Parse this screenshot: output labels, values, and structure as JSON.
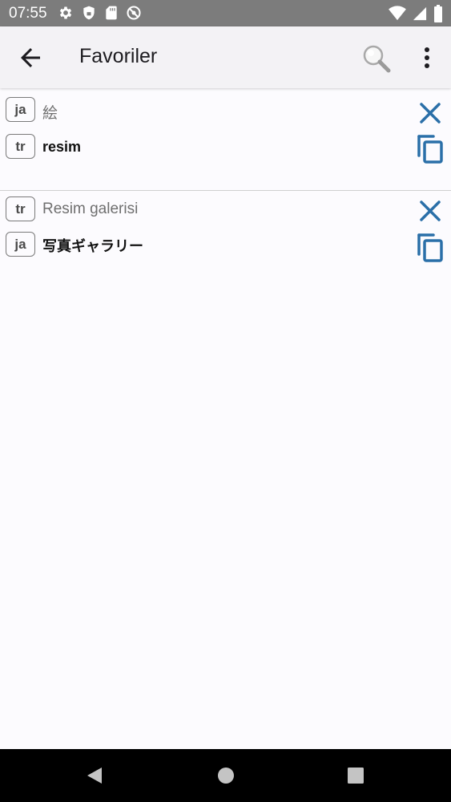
{
  "status_bar": {
    "time": "07:55",
    "left_icons": [
      "gear-icon",
      "shield-icon",
      "sd-card-icon",
      "do-not-disturb-icon"
    ],
    "right_icons": [
      "wifi-icon",
      "signal-icon",
      "battery-icon"
    ]
  },
  "app_bar": {
    "title": "Favoriler",
    "back_icon": "arrow-back-icon",
    "search_icon": "search-icon",
    "more_icon": "more-vert-icon"
  },
  "favorites": [
    {
      "source_lang": "ja",
      "source_text": "絵",
      "target_lang": "tr",
      "target_text": "resim"
    },
    {
      "source_lang": "tr",
      "source_text": "Resim galerisi",
      "target_lang": "ja",
      "target_text": "写真ギャラリー"
    }
  ],
  "nav_bar": {
    "buttons": [
      "back-triangle-icon",
      "home-circle-icon",
      "recents-square-icon"
    ]
  },
  "colors": {
    "accent": "#2a6fa8",
    "status_bar": "#7c7c7c",
    "app_bar": "#f3f2f5"
  }
}
